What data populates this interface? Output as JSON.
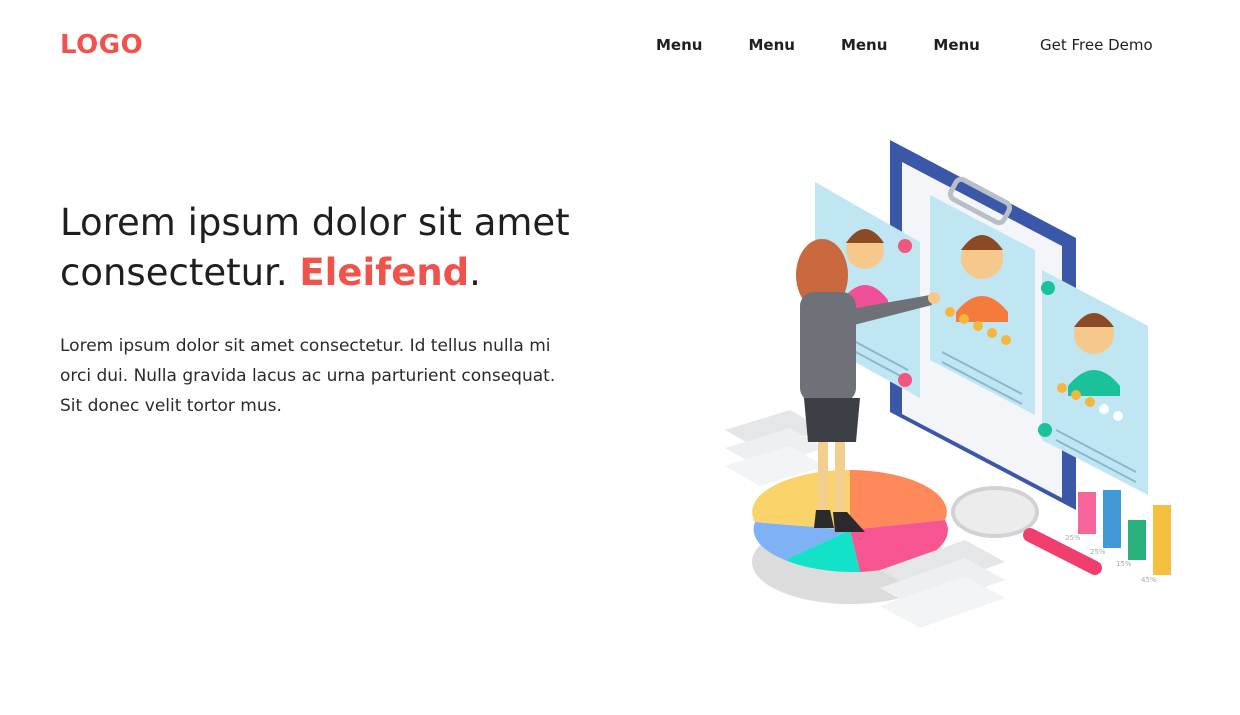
{
  "header": {
    "logo": "LOGO",
    "nav": [
      "Menu",
      "Menu",
      "Menu",
      "Menu"
    ],
    "cta": "Get Free Demo"
  },
  "hero": {
    "title_main": "Lorem ipsum dolor sit amet consectetur. ",
    "title_accent": "Eleifend",
    "title_end": ".",
    "description": "Lorem ipsum dolor sit amet consectetur. Id tellus nulla mi orci dui. Nulla gravida lacus ac urna parturient consequat. Sit donec velit tortor mus."
  },
  "illustration": {
    "icon": "recruitment-illustration",
    "stat_labels": [
      "25%",
      "25%",
      "15%",
      "45%"
    ]
  },
  "colors": {
    "accent": "#f0534b",
    "text": "#1f1f1f"
  }
}
